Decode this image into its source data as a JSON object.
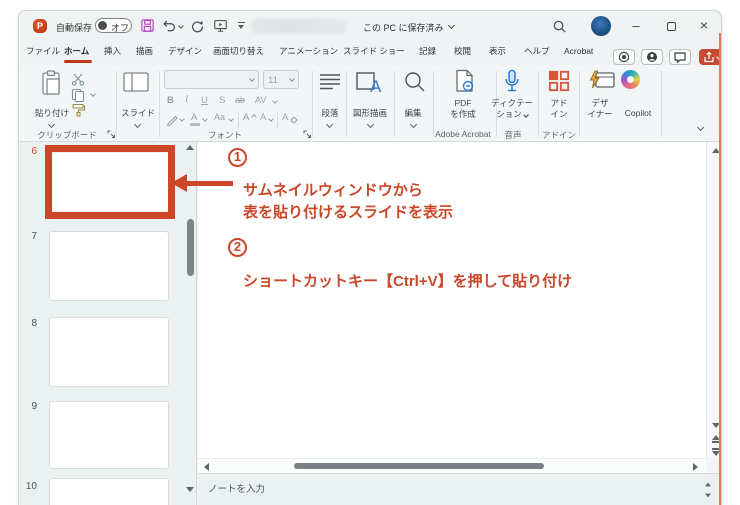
{
  "titlebar": {
    "autosave_label": "自動保存",
    "autosave_state": "オフ",
    "saved_status": "この PC に保存済み"
  },
  "tabs": [
    "ファイル",
    "ホーム",
    "挿入",
    "描画",
    "デザイン",
    "画面切り替え",
    "アニメーション",
    "スライド ショー",
    "記録",
    "校閲",
    "表示",
    "ヘルプ",
    "Acrobat"
  ],
  "ribbon": {
    "clipboard": {
      "paste": "貼り付け",
      "group_label": "クリップボード"
    },
    "slides": {
      "button": "スライド"
    },
    "font": {
      "size": "11",
      "bold": "B",
      "italic": "I",
      "underline": "U",
      "shadow": "S",
      "strikethrough": "ab",
      "spacing": "AV",
      "color": "A",
      "case": "Aa",
      "grow": "A",
      "shrink": "A",
      "clear": "A",
      "group_label": "フォント"
    },
    "paragraph": {
      "button": "段落"
    },
    "drawing": {
      "button": "図形描画"
    },
    "editing": {
      "button": "編集"
    },
    "acrobat": {
      "button": "PDF\nを作成",
      "group_label": "Adobe Acrobat"
    },
    "voice": {
      "button": "ディクテー\nション",
      "group_label": "音声"
    },
    "addins": {
      "button": "アド\nイン",
      "group_label": "アドイン"
    },
    "designer": {
      "button": "デザ\nイナー"
    },
    "copilot": {
      "button": "Copilot"
    }
  },
  "thumbnails": {
    "items": [
      {
        "number": "6"
      },
      {
        "number": "7"
      },
      {
        "number": "8"
      },
      {
        "number": "9"
      },
      {
        "number": "10"
      }
    ],
    "selected": "6"
  },
  "annotations": {
    "step1_number": "1",
    "step1_line1": "サムネイルウィンドウから",
    "step1_line2": "表を貼り付けるスライドを表示",
    "step2_number": "2",
    "step2_line": "ショートカットキー【Ctrl+V】を押して貼り付け"
  },
  "notes": {
    "placeholder": "ノートを入力"
  },
  "colors": {
    "accent": "#c4452b",
    "annotation": "#cb4727",
    "save_icon": "#b43dbb",
    "mic": "#2b7cd5"
  }
}
